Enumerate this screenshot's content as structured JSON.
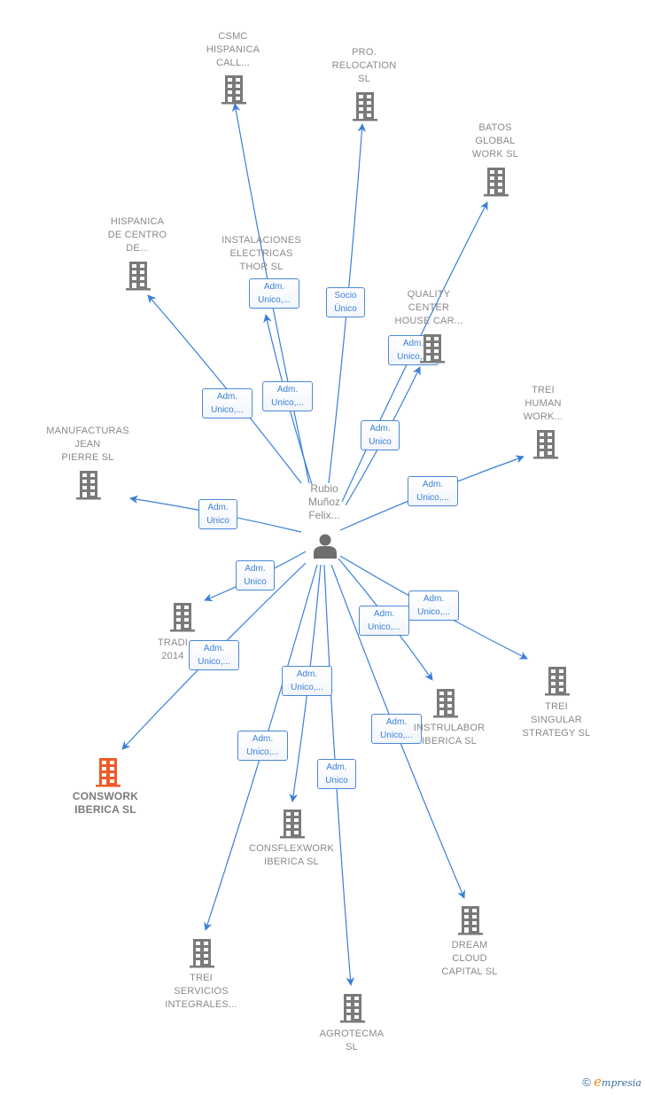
{
  "center": {
    "name": "Rubio\nMuñoz\nFelix...",
    "icon": "person-icon"
  },
  "colors": {
    "edge": "#3a7fd8",
    "node": "#7a7a7a",
    "highlight": "#f05a28",
    "label_text": "#8a8a8a"
  },
  "nodes": [
    {
      "id": "csmc",
      "label": "CSMC\nHISPANICA\nCALL...",
      "icon": "building-icon",
      "highlight": false
    },
    {
      "id": "pro_relocation",
      "label": "PRO.\nRELOCATION\nSL",
      "icon": "building-icon",
      "highlight": false
    },
    {
      "id": "batos",
      "label": "BATOS\nGLOBAL\nWORK  SL",
      "icon": "building-icon",
      "highlight": false
    },
    {
      "id": "hispanica_centro",
      "label": "HISPANICA\nDE CENTRO\nDE...",
      "icon": "building-icon",
      "highlight": false
    },
    {
      "id": "instalaciones",
      "label": "INSTALACIONES\nELECTRICAS\nTHOR  SL",
      "icon": "building-icon",
      "highlight": false
    },
    {
      "id": "quality_center",
      "label": "QUALITY\nCENTER\nHOUSE CAR...",
      "icon": "building-icon",
      "highlight": false
    },
    {
      "id": "trei_human",
      "label": "TREI\nHUMAN\nWORK...",
      "icon": "building-icon",
      "highlight": false
    },
    {
      "id": "manufacturas",
      "label": "MANUFACTURAS\nJEAN\nPIERRE SL",
      "icon": "building-icon",
      "highlight": false
    },
    {
      "id": "tradi",
      "label": "TRADI\n2014",
      "icon": "building-icon",
      "highlight": false
    },
    {
      "id": "conswork",
      "label": "CONSWORK\nIBERICA  SL",
      "icon": "building-icon",
      "highlight": true
    },
    {
      "id": "instrulabor",
      "label": "INSTRULABOR\nIBERICA  SL",
      "icon": "building-icon",
      "highlight": false
    },
    {
      "id": "trei_singular",
      "label": "TREI\nSINGULAR\nSTRATEGY  SL",
      "icon": "building-icon",
      "highlight": false
    },
    {
      "id": "consflexwork",
      "label": "CONSFLEXWORK\nIBERICA  SL",
      "icon": "building-icon",
      "highlight": false
    },
    {
      "id": "dream_cloud",
      "label": "DREAM\nCLOUD\nCAPITAL  SL",
      "icon": "building-icon",
      "highlight": false
    },
    {
      "id": "trei_servicios",
      "label": "TREI\nSERVICIOS\nINTEGRALES...",
      "icon": "building-icon",
      "highlight": false
    },
    {
      "id": "agrotecma",
      "label": "AGROTECMA\nSL",
      "icon": "building-icon",
      "highlight": false
    }
  ],
  "edges": [
    {
      "to": "csmc",
      "label": [
        "Adm.",
        "Unico,..."
      ]
    },
    {
      "to": "pro_relocation",
      "label": [
        "Socio",
        "Único"
      ]
    },
    {
      "to": "batos",
      "label": [
        "Adm.",
        "Unico,..."
      ]
    },
    {
      "to": "hispanica_centro",
      "label": [
        "Adm.",
        "Unico,..."
      ]
    },
    {
      "to": "instalaciones",
      "label": [
        "Adm.",
        "Unico,..."
      ]
    },
    {
      "to": "quality_center",
      "label": [
        "Adm.",
        "Unico"
      ]
    },
    {
      "to": "trei_human",
      "label": [
        "Adm.",
        "Unico,..."
      ]
    },
    {
      "to": "manufacturas",
      "label": [
        "Adm.",
        "Unico"
      ]
    },
    {
      "to": "tradi",
      "label": [
        "Adm.",
        "Unico"
      ]
    },
    {
      "to": "conswork",
      "label": [
        "Adm.",
        "Unico,..."
      ]
    },
    {
      "to": "instrulabor",
      "label": [
        "Adm.",
        "Unico,..."
      ]
    },
    {
      "to": "trei_singular",
      "label": [
        "Adm.",
        "Unico,..."
      ]
    },
    {
      "to": "consflexwork",
      "label": [
        "Adm.",
        "Unico,..."
      ]
    },
    {
      "to": "dream_cloud",
      "label": [
        "Adm.",
        "Unico,..."
      ]
    },
    {
      "to": "trei_servicios",
      "label": [
        "Adm.",
        "Unico,..."
      ]
    },
    {
      "to": "agrotecma",
      "label": [
        "Adm.",
        "Unico"
      ]
    }
  ],
  "footer": {
    "copyright_symbol": "©",
    "brand_initial": "e",
    "brand_rest": "mpresia"
  }
}
